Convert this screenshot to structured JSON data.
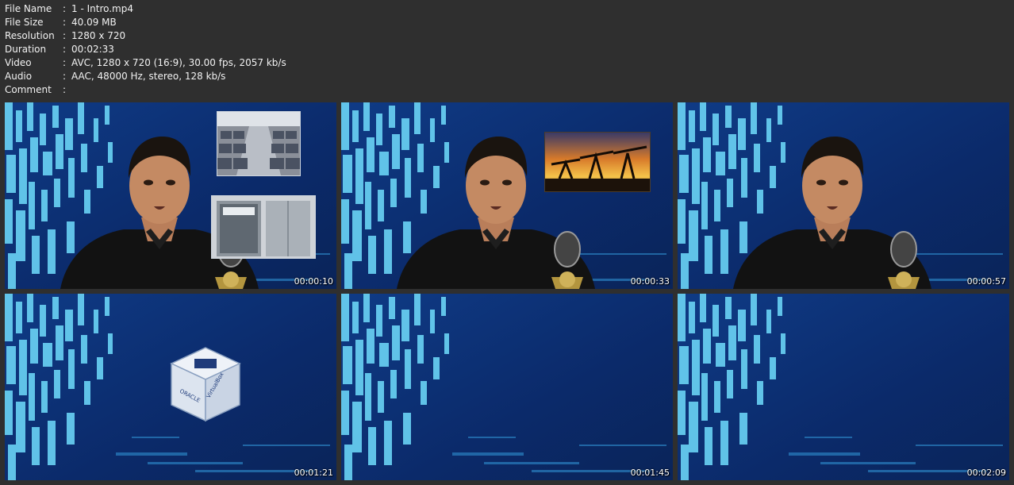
{
  "media_info": [
    {
      "key": "File Name",
      "sep": ":",
      "value": "1 - Intro.mp4"
    },
    {
      "key": "File Size",
      "sep": ":",
      "value": "40.09 MB"
    },
    {
      "key": "Resolution",
      "sep": ":",
      "value": "1280 x 720"
    },
    {
      "key": "Duration",
      "sep": ":",
      "value": "00:02:33"
    },
    {
      "key": "Video",
      "sep": ":",
      "value": "AVC, 1280 x 720 (16:9), 30.00 fps, 2057 kb/s"
    },
    {
      "key": "Audio",
      "sep": ":",
      "value": "AAC, 48000 Hz, stereo, 128 kb/s"
    },
    {
      "key": "Comment",
      "sep": ":",
      "value": ""
    }
  ],
  "thumbnails": [
    {
      "timestamp": "00:00:10",
      "content": "presenter with airplane cabin and elevator images"
    },
    {
      "timestamp": "00:00:33",
      "content": "presenter with oil pump jacks at sunset image"
    },
    {
      "timestamp": "00:00:57",
      "content": "presenter"
    },
    {
      "timestamp": "00:01:21",
      "content": "VirtualBox logo",
      "logo_text": [
        "ORACLE",
        "VirtualBox"
      ]
    },
    {
      "timestamp": "00:01:45",
      "content": "blue abstract background"
    },
    {
      "timestamp": "00:02:09",
      "content": "blue abstract background"
    }
  ],
  "colors": {
    "page_background": "#2f2f2f",
    "text": "#f2f2f2",
    "video_background": "#0d2a66",
    "tile_accent": "#5cc8f0"
  }
}
